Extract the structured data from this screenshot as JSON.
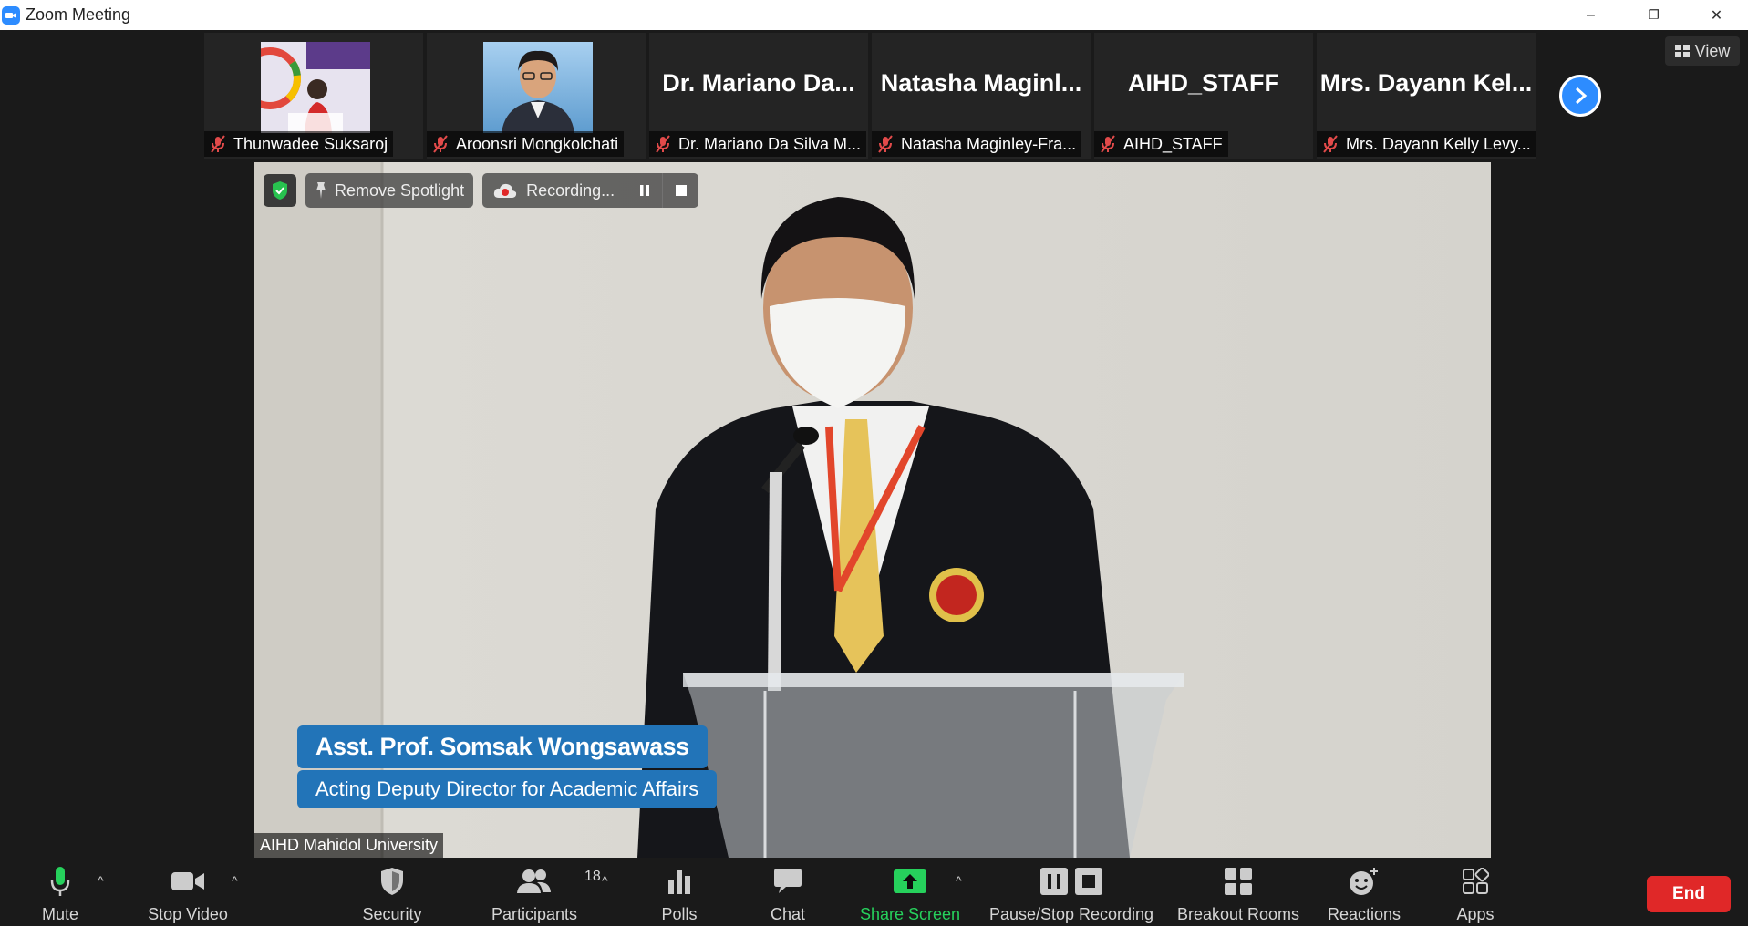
{
  "window": {
    "title": "Zoom Meeting",
    "minimize_icon": "–",
    "restore_icon": "❐",
    "close_icon": "✕"
  },
  "thumbnails": [
    {
      "name": "Thunwadee  Suksaroj",
      "video": "photo-banner",
      "muted": true
    },
    {
      "name": "Aroonsri Mongkolchati",
      "video": "photo-portrait",
      "muted": true
    },
    {
      "name": "Dr. Mariano Da Silva M...",
      "big_name": "Dr. Mariano Da...",
      "muted": true
    },
    {
      "name": "Natasha Maginley-Fra...",
      "big_name": "Natasha  Maginl...",
      "muted": true
    },
    {
      "name": "AIHD_STAFF",
      "big_name": "AIHD_STAFF",
      "muted": true
    },
    {
      "name": "Mrs. Dayann Kelly Levy...",
      "big_name": "Mrs.  Dayann  Kel...",
      "muted": true
    }
  ],
  "view_button": "View",
  "video": {
    "remove_spotlight": "Remove Spotlight",
    "recording": "Recording...",
    "lower_third_name": "Asst. Prof. Somsak Wongsawass",
    "lower_third_role": "Acting Deputy Director for Academic Affairs",
    "speaker_label": "AIHD Mahidol University"
  },
  "toolbar": {
    "mute": "Mute",
    "stop_video": "Stop Video",
    "security": "Security",
    "participants": "Participants",
    "participants_count": "18",
    "polls": "Polls",
    "chat": "Chat",
    "share_screen": "Share Screen",
    "pause_stop_recording": "Pause/Stop Recording",
    "breakout_rooms": "Breakout Rooms",
    "reactions": "Reactions",
    "apps": "Apps",
    "end": "End"
  },
  "colors": {
    "accent": "#2d8cff",
    "share_green": "#26d15c",
    "end_red": "#e02828",
    "lower_third_blue": "#2274b8"
  }
}
